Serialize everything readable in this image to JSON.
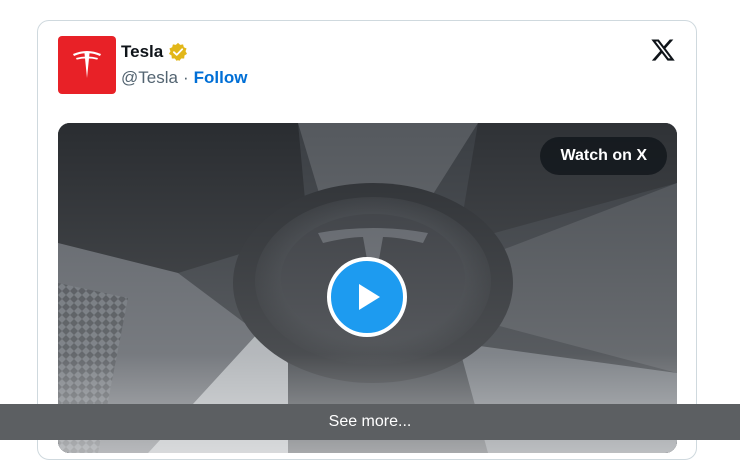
{
  "tweet": {
    "author_name": "Tesla",
    "handle": "@Tesla",
    "separator": "·",
    "follow_label": "Follow",
    "verified": true,
    "avatar_brand_color": "#e82127",
    "verified_badge_color": "#e2b719"
  },
  "media": {
    "watch_label": "Watch on X",
    "play_button_color": "#1d9bf0"
  },
  "footer": {
    "see_more_label": "See more..."
  },
  "icons": {
    "avatar": "tesla-logo-icon",
    "badge": "verified-badge-icon",
    "brand": "x-logo-icon",
    "play": "play-icon"
  }
}
